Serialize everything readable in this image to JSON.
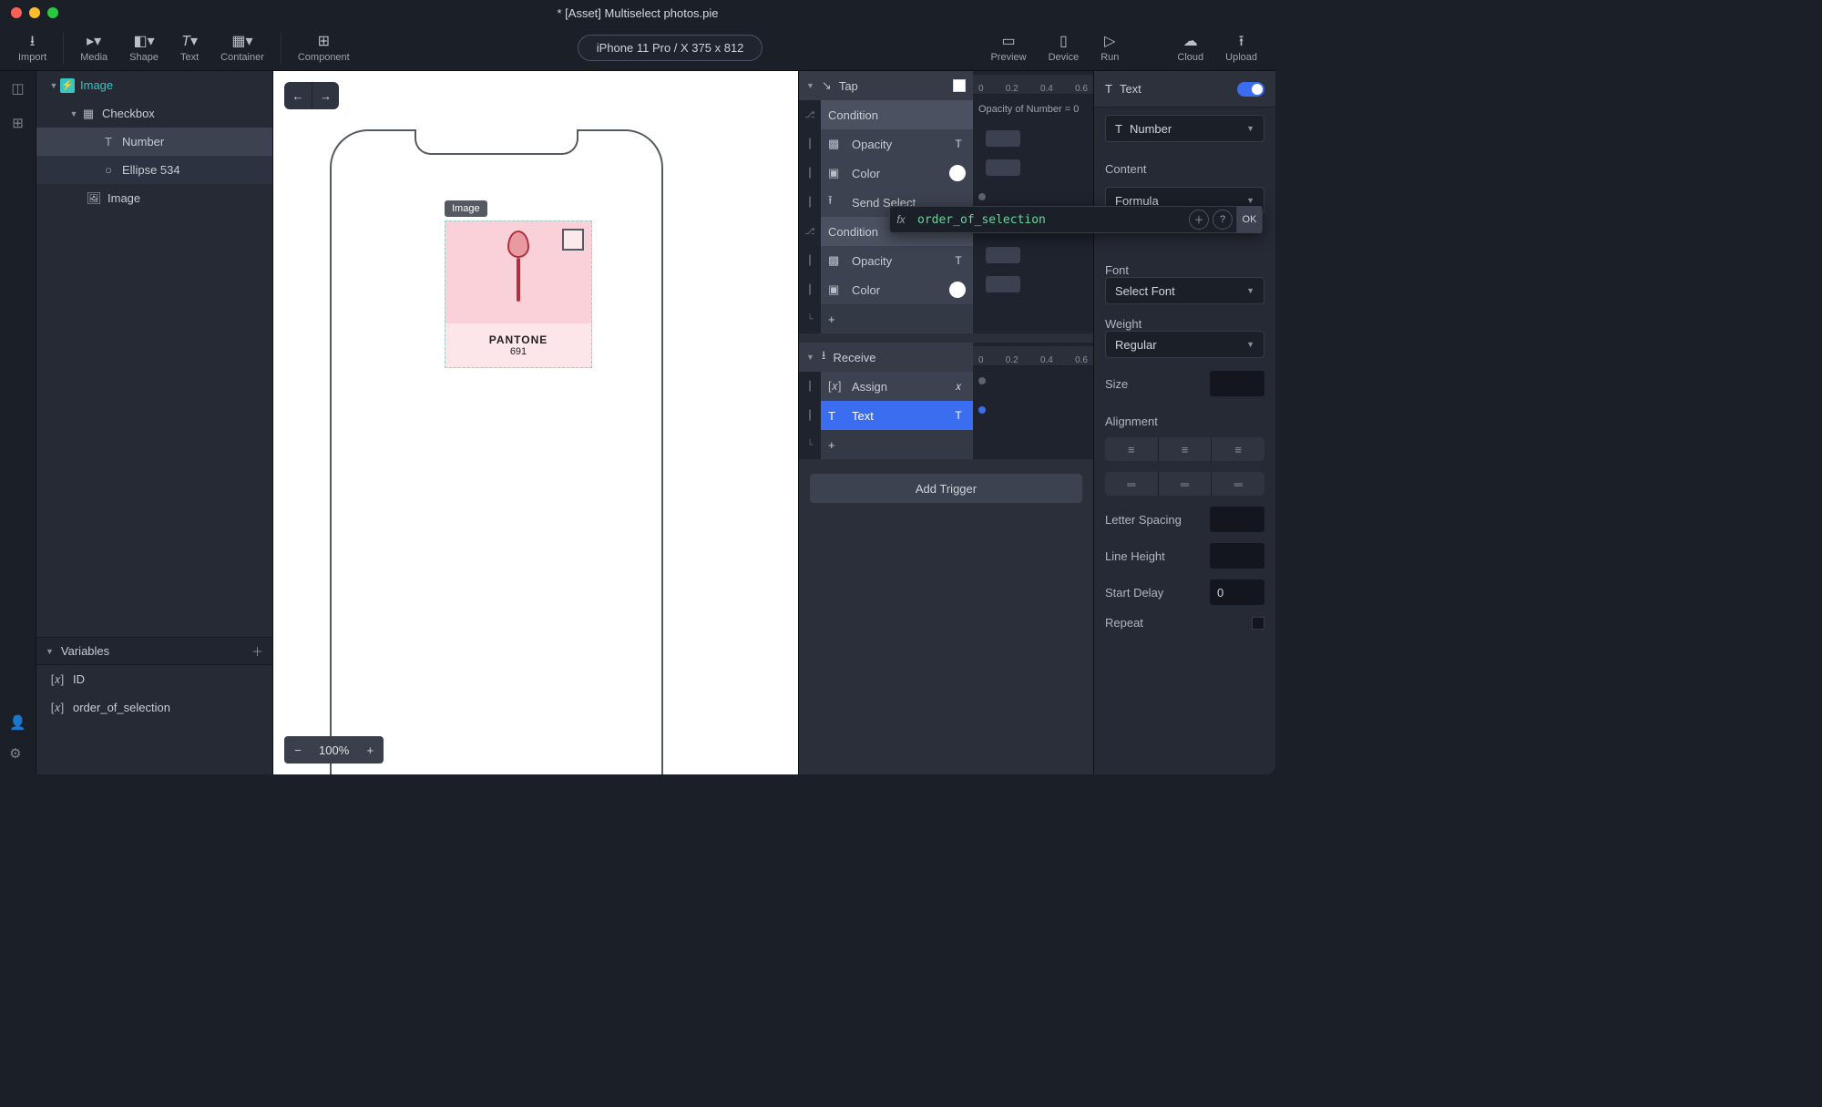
{
  "title": "* [Asset] Multiselect photos.pie",
  "toolbar": {
    "import": "Import",
    "media": "Media",
    "shape": "Shape",
    "text": "Text",
    "container": "Container",
    "component": "Component",
    "device_pill": "iPhone 11 Pro / X  375 x 812",
    "preview": "Preview",
    "device": "Device",
    "run": "Run",
    "cloud": "Cloud",
    "upload": "Upload"
  },
  "tree": {
    "root": "Image",
    "checkbox": "Checkbox",
    "number": "Number",
    "ellipse": "Ellipse 534",
    "image2": "Image"
  },
  "variables": {
    "title": "Variables",
    "id": "ID",
    "order": "order_of_selection"
  },
  "canvas": {
    "img_label": "Image",
    "pantone": "PANTONE",
    "pantone_num": "691",
    "zoom": "100%"
  },
  "triggers": {
    "tap": "Tap",
    "receive": "Receive",
    "add": "Add Trigger",
    "ruler": [
      "0",
      "0.2",
      "0.4",
      "0.6"
    ],
    "tap_rows": [
      "Condition",
      "Opacity",
      "Color",
      "Send Select",
      "Condition",
      "Opacity",
      "Color",
      "+"
    ],
    "cond_text": "Opacity of Number = 0",
    "recv_rows": [
      "Assign",
      "Text",
      "+"
    ]
  },
  "props": {
    "head": "Text",
    "target": "Number",
    "content_label": "Content",
    "content_sel": "Formula",
    "font_label": "Font",
    "font_sel": "Select Font",
    "weight_label": "Weight",
    "weight_sel": "Regular",
    "size": "Size",
    "alignment": "Alignment",
    "letter": "Letter Spacing",
    "line": "Line Height",
    "delay": "Start Delay",
    "delay_v": "0",
    "repeat": "Repeat"
  },
  "formula": {
    "code": "order_of_selection",
    "ok": "OK"
  }
}
